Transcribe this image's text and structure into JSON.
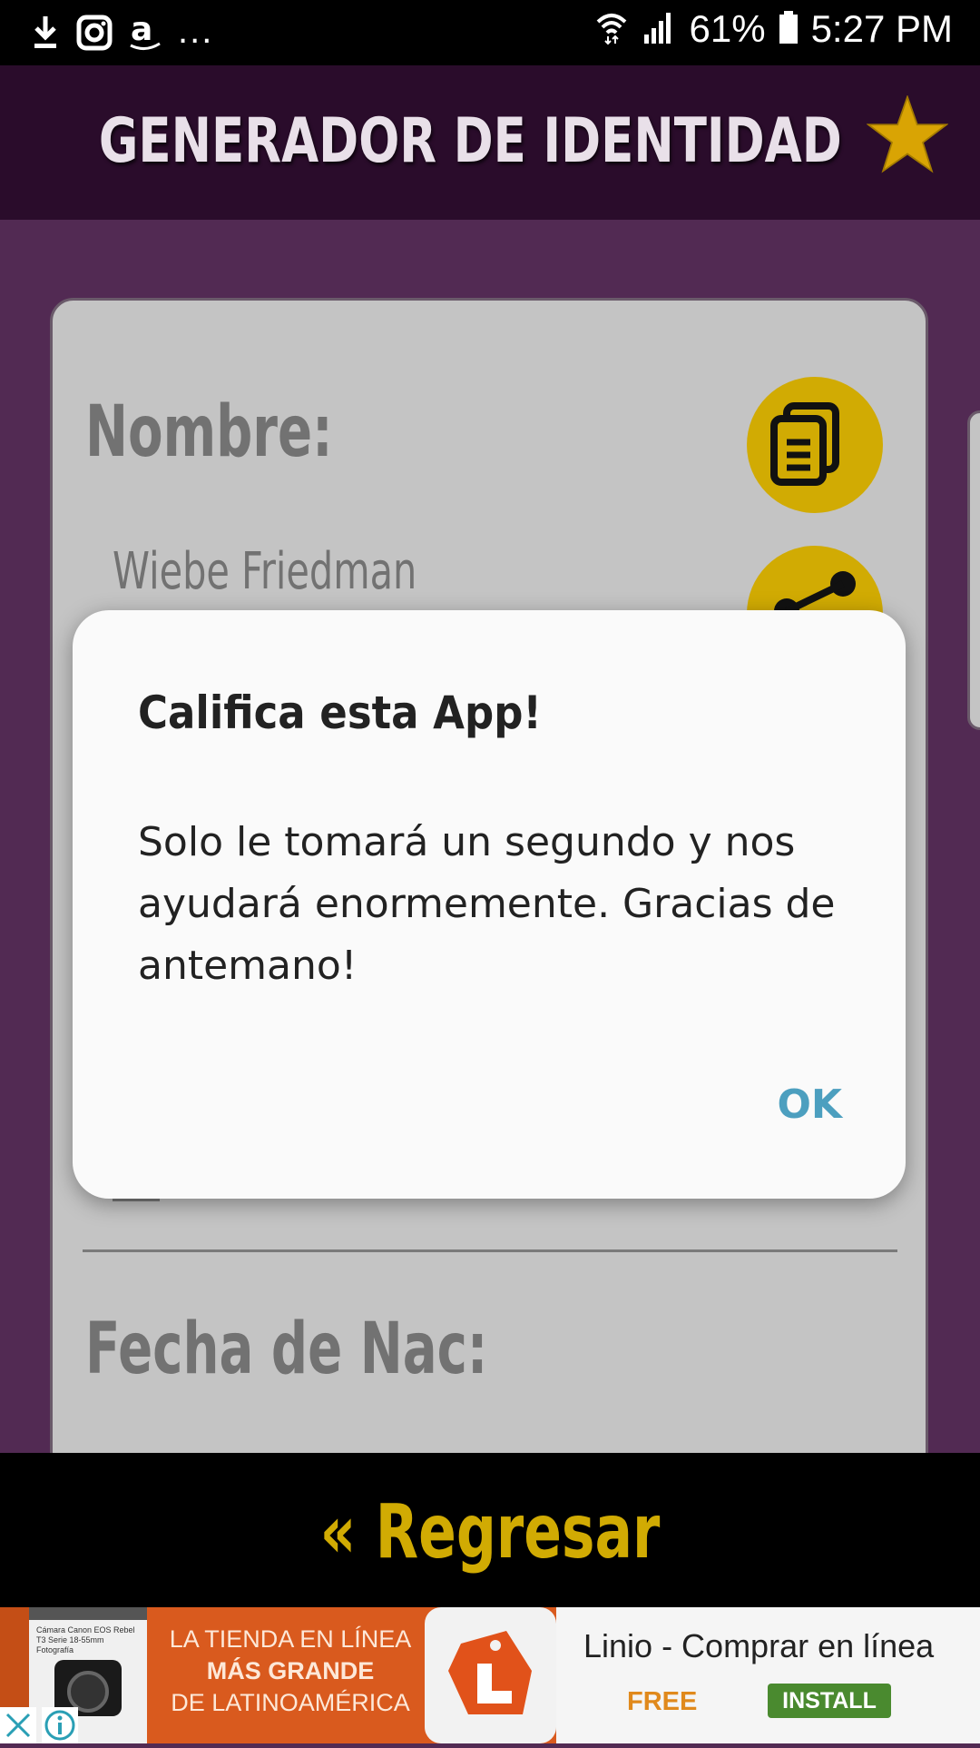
{
  "status_bar": {
    "battery": "61%",
    "time": "5:27 PM",
    "more": "...",
    "icons": [
      "download-icon",
      "instagram-icon",
      "amazon-icon",
      "wifi-icon",
      "signal-icon",
      "battery-icon"
    ]
  },
  "header": {
    "title": "GENERADOR DE IDENTIDAD",
    "favorite_icon": "star-icon"
  },
  "card": {
    "name_label": "Nombre:",
    "name_value": "Wiebe Friedman",
    "birth_label": "Fecha de Nac:",
    "copy_icon": "copy-icon",
    "share_icon": "share-icon"
  },
  "dialog": {
    "title": "Califica esta App!",
    "message": "Solo le tomará un segundo y nos ayudará enormemente. Gracias de antemano!",
    "ok_label": "OK"
  },
  "back_button": {
    "label": "« Regresar"
  },
  "ad": {
    "slogan_line1": "LA TIENDA EN LÍNEA",
    "slogan_line2": "MÁS GRANDE",
    "slogan_line3": "DE LATINOAMÉRICA",
    "app_title": "Linio - Comprar en línea",
    "price": "FREE",
    "install_label": "INSTALL",
    "thumb_text": "Cámara Canon EOS Rebel T3 Serie 18-55mm Fotografía",
    "colors": {
      "brand": "#d95a1e",
      "install": "#4a8a2f",
      "free": "#e0891c"
    }
  },
  "colors": {
    "background": "#522a53",
    "header": "#2a0c2b",
    "accent": "#d1ab03",
    "dialog_button": "#4c9fbf"
  }
}
